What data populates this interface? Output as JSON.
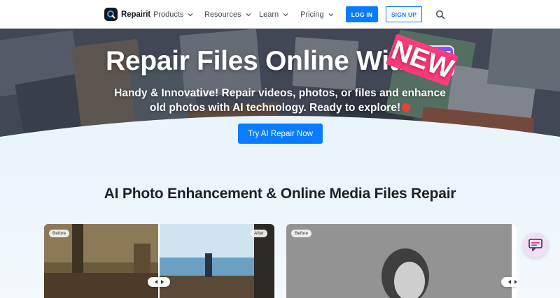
{
  "nav": {
    "brand": "Repairit",
    "items": [
      {
        "label": "Products"
      },
      {
        "label": "Resources"
      },
      {
        "label": "Learn"
      },
      {
        "label": "Pricing"
      }
    ],
    "login_label": "LOG IN",
    "signup_label": "SIGN UP",
    "icons": {
      "logo": "repairit-logo-icon",
      "chevron": "chevron-down-icon",
      "search": "search-icon"
    }
  },
  "hero": {
    "title": "Repair Files Online With",
    "ai_badge": "AI",
    "ai_badge_tag": "NEW",
    "subtitle": "Handy & Innovative! Repair videos, photos, or files and enhance old photos with AI technology. Ready to explore!",
    "cta_label": "Try AI Repair Now"
  },
  "section": {
    "title": "AI Photo Enhancement & Online Media Files Repair",
    "cards": [
      {
        "before_label": "Before",
        "after_label": "After"
      },
      {
        "before_label": "Before"
      }
    ]
  },
  "colors": {
    "accent": "#0a7cff",
    "section_bg": "#eaf4fb",
    "text_dark": "#1f2024",
    "chat_bg": "#f3dff5"
  },
  "icons": {
    "chat": "chat-support-icon",
    "rocket": "rocket-icon",
    "slider": "compare-slider-handle-icon"
  }
}
